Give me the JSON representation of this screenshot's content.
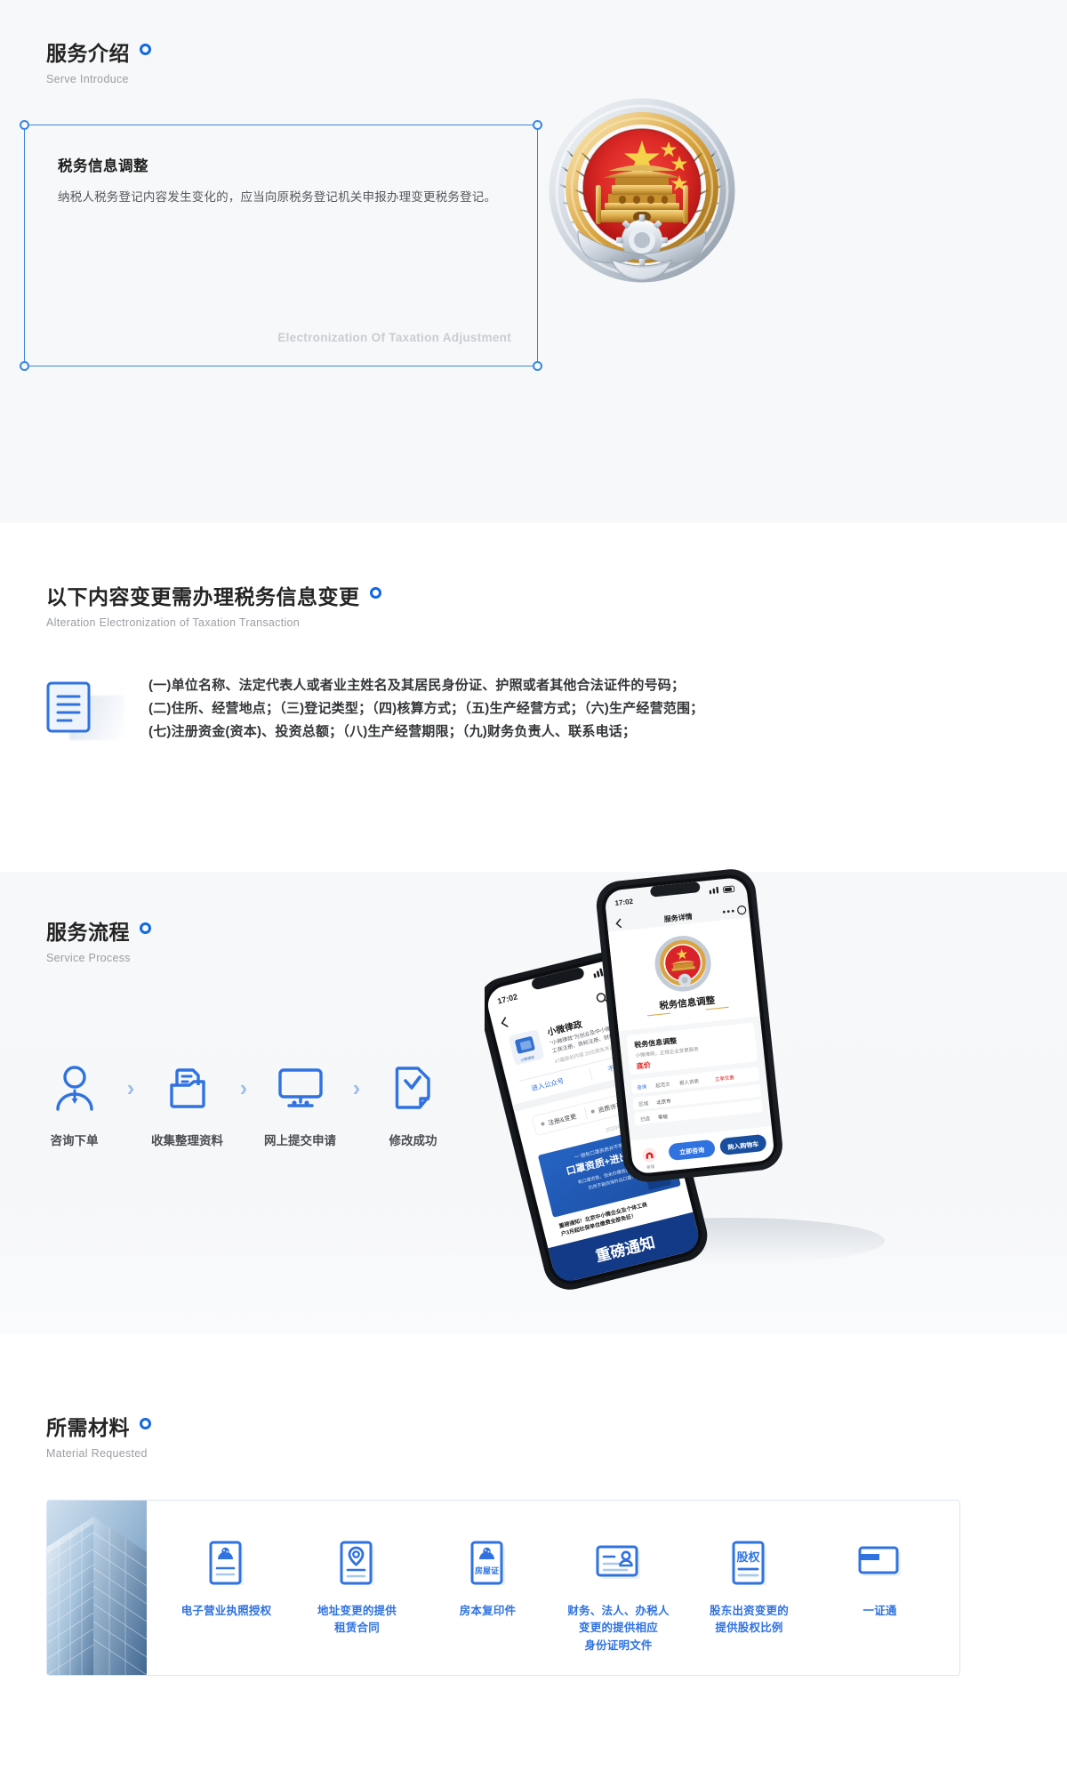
{
  "intro": {
    "title": "服务介绍",
    "dot": "circle-marker",
    "subtitle": "Serve Introduce",
    "card": {
      "title": "税务信息调整",
      "body": "纳税人税务登记内容发生变化的，应当向原税务登记机关申报办理变更税务登记。",
      "watermark": "Electronization Of Taxation Adjustment"
    },
    "emblem_name": "national-emblem-of-china"
  },
  "alteration": {
    "title": "以下内容变更需办理税务信息变更",
    "subtitle": "Alteration  Electronization of Taxation Transaction",
    "lines": [
      "(一)单位名称、法定代表人或者业主姓名及其居民身份证、护照或者其他合法证件的号码；",
      "(二)住所、经营地点；（三)登记类型；（四)核算方式；（五)生产经营方式；（六)生产经营范围；",
      "(七)注册资金(资本)、投资总额；（八)生产经营期限；（九)财务负责人、联系电话；"
    ]
  },
  "process": {
    "title": "服务流程",
    "subtitle": "Service Process",
    "steps": [
      {
        "label": "咨询下单",
        "icon": "user-icon"
      },
      {
        "label": "收集整理资料",
        "icon": "file-box-icon"
      },
      {
        "label": "网上提交申请",
        "icon": "monitor-icon"
      },
      {
        "label": "修改成功",
        "icon": "document-check-icon"
      }
    ],
    "separator": "chevron-right-icon",
    "phone_left": {
      "status_time": "17:02",
      "account_name": "小微律政",
      "account_desc": "“小微律政”为创业及中小微企业提供工商注册、商标注册、财税代理、…",
      "account_stats": "47篇原创内容    25位朋友关注",
      "btn_enter": "进入公众号",
      "btn_unfollow": "不再关注",
      "tags": [
        "注册&变更",
        "资质许可"
      ],
      "date": "2020年3月12日 14:06",
      "banner_line1": "一 拥有口罩资质并不等于 一",
      "banner_line2": "口罩资质+进出口权",
      "banner_line3": "有口罩资质，但未办理进出口权，仍然不能向海外出口罩！",
      "notice_title": "重磅通知！北京中小微企业及个体工商户3月起可减免6月社保单位缴费全部免征！",
      "footer": "重磅通知"
    },
    "phone_right": {
      "status_time": "17:02",
      "nav_title": "服务详情",
      "service_title": "税务信息调整",
      "card_title": "税务信息调整",
      "card_sub": "小微律政，正规企业变更服务",
      "price_label": "底价",
      "tabs": [
        "查询",
        "起范文",
        "报人资质",
        "立享进优价"
      ],
      "tab_active": "立享优惠",
      "rows": [
        "区域  北京市",
        "已选  零税"
      ],
      "btn_primary": "立即咨询",
      "btn_secondary": "购入购物车",
      "hotline_icon": "headset-icon"
    }
  },
  "materials": {
    "title": "所需材料",
    "subtitle": "Material Requested",
    "photo_name": "office-building-photo",
    "items": [
      {
        "label": "电子营业执照授权",
        "icon": "license-doc-icon",
        "badge": ""
      },
      {
        "label": "地址变更的提供\n租赁合同",
        "line1": "地址变更的提供",
        "line2": "租赁合同",
        "icon": "location-doc-icon",
        "badge": ""
      },
      {
        "label": "房本复印件",
        "icon": "house-cert-icon",
        "badge": "房屋证"
      },
      {
        "label": "财务、法人、办税人\n变更的提供相应\n身份证明文件",
        "line1": "财务、法人、办税人",
        "line2": "变更的提供相应",
        "line3": "身份证明文件",
        "icon": "id-card-icon",
        "badge": ""
      },
      {
        "label": "股东出资变更的\n提供股权比例",
        "line1": "股东出资变更的",
        "line2": "提供股权比例",
        "icon": "equity-doc-icon",
        "badge": "股权"
      },
      {
        "label": "一证通",
        "icon": "card-icon",
        "badge": ""
      }
    ]
  },
  "colors": {
    "accent": "#1268e3",
    "accent_light": "#2f72e0",
    "border_blue": "#3a87e0",
    "panel_border": "#dbe6f5",
    "bg_grey": "#f7f8f9",
    "text_dark": "#242424",
    "text_muted": "#9a9da2",
    "watermark": "#c9ccd1",
    "chevron": "#9dbdf0",
    "emblem_red": "#d8232a",
    "emblem_gold": "#d9a441"
  }
}
